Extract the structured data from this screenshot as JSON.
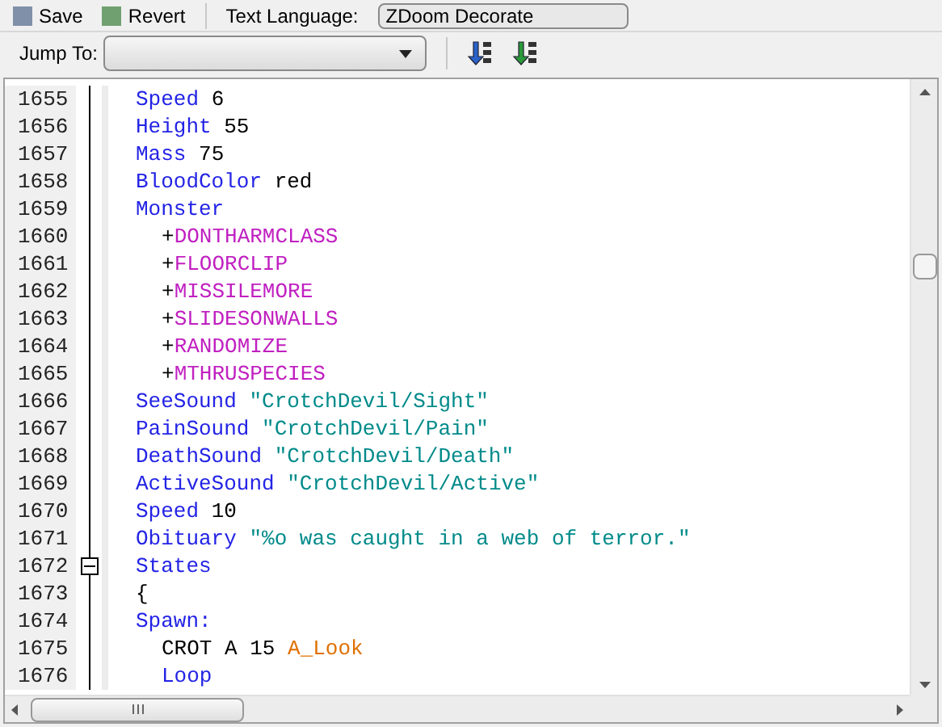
{
  "toolbar": {
    "save": "Save",
    "revert": "Revert",
    "language_label": "Text Language:",
    "language_value": "ZDoom Decorate"
  },
  "jump": {
    "label": "Jump To:"
  },
  "editor": {
    "lines": [
      {
        "number": "1655",
        "tokens": [
          {
            "kind": "keyword",
            "text": "Speed"
          },
          {
            "kind": "plain",
            "text": " 6"
          }
        ]
      },
      {
        "number": "1656",
        "tokens": [
          {
            "kind": "keyword",
            "text": "Height"
          },
          {
            "kind": "plain",
            "text": " 55"
          }
        ]
      },
      {
        "number": "1657",
        "tokens": [
          {
            "kind": "keyword",
            "text": "Mass"
          },
          {
            "kind": "plain",
            "text": " 75"
          }
        ]
      },
      {
        "number": "1658",
        "tokens": [
          {
            "kind": "keyword",
            "text": "BloodColor"
          },
          {
            "kind": "plain",
            "text": " red"
          }
        ]
      },
      {
        "number": "1659",
        "tokens": [
          {
            "kind": "keyword",
            "text": "Monster"
          }
        ],
        "children": [
          {
            "number": "1660",
            "tokens": [
              {
                "kind": "plain",
                "text": "+"
              },
              {
                "kind": "flag",
                "text": "DONTHARMCLASS"
              }
            ]
          },
          {
            "number": "1661",
            "tokens": [
              {
                "kind": "plain",
                "text": "+"
              },
              {
                "kind": "flag",
                "text": "FLOORCLIP"
              }
            ]
          },
          {
            "number": "1662",
            "tokens": [
              {
                "kind": "plain",
                "text": "+"
              },
              {
                "kind": "flag",
                "text": "MISSILEMORE"
              }
            ]
          },
          {
            "number": "1663",
            "tokens": [
              {
                "kind": "plain",
                "text": "+"
              },
              {
                "kind": "flag",
                "text": "SLIDESONWALLS"
              }
            ]
          },
          {
            "number": "1664",
            "tokens": [
              {
                "kind": "plain",
                "text": "+"
              },
              {
                "kind": "flag",
                "text": "RANDOMIZE"
              }
            ]
          },
          {
            "number": "1665",
            "tokens": [
              {
                "kind": "plain",
                "text": "+"
              },
              {
                "kind": "flag",
                "text": "MTHRUSPECIES"
              }
            ]
          }
        ]
      },
      {
        "number": "1666",
        "tokens": [
          {
            "kind": "keyword",
            "text": "SeeSound"
          },
          {
            "kind": "string",
            "text": "\"CrotchDevil/Sight\""
          }
        ]
      },
      {
        "number": "1667",
        "tokens": [
          {
            "kind": "keyword",
            "text": "PainSound"
          },
          {
            "kind": "string",
            "text": "\"CrotchDevil/Pain\""
          }
        ]
      },
      {
        "number": "1668",
        "tokens": [
          {
            "kind": "keyword",
            "text": "DeathSound"
          },
          {
            "kind": "string",
            "text": "\"CrotchDevil/Death\""
          }
        ]
      },
      {
        "number": "1669",
        "tokens": [
          {
            "kind": "keyword",
            "text": "ActiveSound"
          },
          {
            "kind": "string",
            "text": "\"CrotchDevil/Active\""
          }
        ]
      },
      {
        "number": "1670",
        "tokens": [
          {
            "kind": "keyword",
            "text": "Speed"
          },
          {
            "kind": "plain",
            "text": " 10"
          }
        ]
      },
      {
        "number": "1671",
        "tokens": [
          {
            "kind": "keyword",
            "text": "Obituary"
          },
          {
            "kind": "string",
            "text": "\"%o was caught in a web of terror.\""
          }
        ]
      },
      {
        "number": "1672",
        "fold": {
          "expanded": true
        },
        "tokens": [
          {
            "kind": "keyword",
            "text": "States"
          }
        ]
      },
      {
        "number": "1673",
        "tokens": [
          {
            "kind": "plain",
            "text": "{"
          }
        ]
      },
      {
        "number": "1674",
        "tokens": [
          {
            "kind": "keyword",
            "text": "Spawn:"
          }
        ],
        "children": [
          {
            "number": "1675",
            "tokens": [
              {
                "kind": "plain",
                "text": "CROT A 15 "
              },
              {
                "kind": "action",
                "text": "A_Look"
              }
            ]
          },
          {
            "number": "1676",
            "tokens": [
              {
                "kind": "keyword",
                "text": "Loop"
              }
            ]
          }
        ]
      }
    ]
  }
}
